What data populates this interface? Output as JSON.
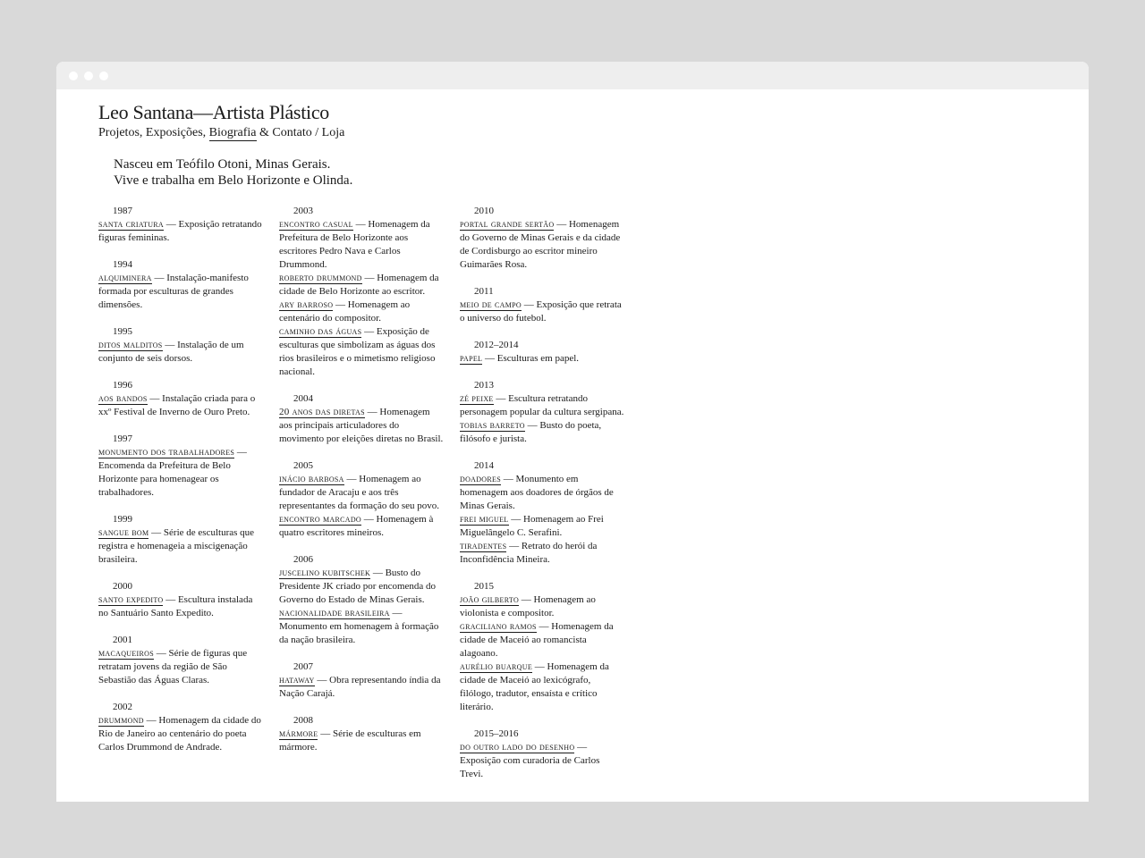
{
  "site": {
    "title": "Leo Santana—Artista Plástico",
    "nav": [
      {
        "label": "Projetos,"
      },
      {
        "label": " Exposições,"
      },
      {
        "label": "Biografia"
      },
      {
        "label": " & Contato"
      },
      {
        "label": " / Loja"
      }
    ]
  },
  "intro": {
    "line1": "Nasceu em Teófilo Otoni, Minas Gerais.",
    "line2": "Vive e trabalha em Belo Horizonte e Olinda."
  },
  "columns": [
    [
      {
        "year": "1987",
        "items": [
          {
            "title": "Santa Criatura",
            "desc": " — Exposição retratando figuras femininas."
          }
        ]
      },
      {
        "year": "1994",
        "items": [
          {
            "title": "Alquiminera",
            "desc": " — Instalação-manifesto formada por esculturas de grandes dimensões."
          }
        ]
      },
      {
        "year": "1995",
        "items": [
          {
            "title": "Ditos Malditos",
            "desc": " — Instalação de um conjunto de seis dorsos."
          }
        ]
      },
      {
        "year": "1996",
        "items": [
          {
            "title": "Aos Bandos",
            "desc": " — Instalação criada para o xxº Festival de Inverno de Ouro Preto."
          }
        ]
      },
      {
        "year": "1997",
        "items": [
          {
            "title": "Monumento dos Trabalhadores",
            "desc": " — Encomenda da Prefeitura de Belo Horizonte para homenagear os trabalhadores."
          }
        ]
      },
      {
        "year": "1999",
        "items": [
          {
            "title": "Sangue Bom",
            "desc": " — Série de esculturas que registra e homenageia a miscigenação brasileira."
          }
        ]
      },
      {
        "year": "2000",
        "items": [
          {
            "title": "Santo Expedito",
            "desc": " — Escultura instalada no Santuário Santo Expedito."
          }
        ]
      },
      {
        "year": "2001",
        "items": [
          {
            "title": "Macaqueiros",
            "desc": " — Série de figuras que retratam jovens da região de São Sebastião das Águas Claras."
          }
        ]
      },
      {
        "year": "2002",
        "items": [
          {
            "title": "Drummond",
            "desc": " — Homenagem da cidade do Rio de Janeiro ao centenário do poeta Carlos Drummond de Andrade."
          }
        ]
      }
    ],
    [
      {
        "year": "2003",
        "items": [
          {
            "title": "Encontro Casual",
            "desc": " — Homenagem da Prefeitura de Belo Horizonte aos escritores Pedro Nava e Carlos Drummond."
          },
          {
            "title": "Roberto Drummond",
            "desc": " — Homenagem da cidade de Belo Horizonte ao escritor."
          },
          {
            "title": "Ary Barroso",
            "desc": " — Homenagem ao centenário do compositor."
          },
          {
            "title": "Caminho das Águas",
            "desc": " — Exposição de esculturas que simbolizam as águas dos rios brasileiros e o mimetismo religioso nacional."
          }
        ]
      },
      {
        "year": "2004",
        "items": [
          {
            "title": "20 Anos das Diretas",
            "desc": " — Homenagem aos principais articuladores do movimento por eleições diretas no Brasil."
          }
        ]
      },
      {
        "year": "2005",
        "items": [
          {
            "title": "Inácio Barbosa",
            "desc": " — Homenagem ao fundador de Aracaju e aos três representantes da formação do seu povo."
          },
          {
            "title": "Encontro Marcado",
            "desc": " — Homenagem à quatro escritores mineiros."
          }
        ]
      },
      {
        "year": "2006",
        "items": [
          {
            "title": "Juscelino Kubitschek",
            "desc": " — Busto do Presidente JK criado por encomenda do Governo do Estado de Minas Gerais."
          },
          {
            "title": "Nacionalidade Brasileira",
            "desc": " — Monumento em homenagem à formação da nação brasileira."
          }
        ]
      },
      {
        "year": "2007",
        "items": [
          {
            "title": "Hataway",
            "desc": " — Obra representando índia da Nação Carajá."
          }
        ]
      },
      {
        "year": "2008",
        "items": [
          {
            "title": "Mármore",
            "desc": " — Série de esculturas em mármore."
          }
        ]
      }
    ],
    [
      {
        "year": "2010",
        "items": [
          {
            "title": "Portal Grande Sertão",
            "desc": " — Homenagem do Governo de Minas Gerais e da cidade de Cordisburgo ao escritor mineiro Guimarães Rosa."
          }
        ]
      },
      {
        "year": "2011",
        "items": [
          {
            "title": "Meio de Campo",
            "desc": " — Exposição que retrata o universo do futebol."
          }
        ]
      },
      {
        "year": "2012–2014",
        "items": [
          {
            "title": "Papel",
            "desc": " — Esculturas em papel."
          }
        ]
      },
      {
        "year": "2013",
        "items": [
          {
            "title": "Zé Peixe",
            "desc": " — Escultura retratando personagem popular da cultura sergipana."
          },
          {
            "title": "Tobias Barreto",
            "desc": " — Busto do poeta, filósofo e jurista."
          }
        ]
      },
      {
        "year": "2014",
        "items": [
          {
            "title": "Doadores",
            "desc": " — Monumento em homenagem aos doadores de órgãos de Minas Gerais."
          },
          {
            "title": "Frei Miguel",
            "desc": " — Homenagem ao Frei Miguelângelo C. Serafini."
          },
          {
            "title": "Tiradentes",
            "desc": " — Retrato do herói da Inconfidência Mineira."
          }
        ]
      },
      {
        "year": "2015",
        "items": [
          {
            "title": "João Gilberto",
            "desc": " — Homenagem ao violonista e compositor."
          },
          {
            "title": "Graciliano Ramos",
            "desc": " — Homenagem da cidade de Maceió ao romancista alagoano."
          },
          {
            "title": "Aurélio Buarque",
            "desc": " — Homenagem da cidade de Maceió ao lexicógrafo, filólogo, tradutor, ensaísta e crítico literário."
          }
        ]
      },
      {
        "year": "2015–2016",
        "items": [
          {
            "title": "Do Outro Lado do Desenho",
            "desc": " — Exposição com curadoria de Carlos Trevi."
          }
        ]
      }
    ]
  ]
}
